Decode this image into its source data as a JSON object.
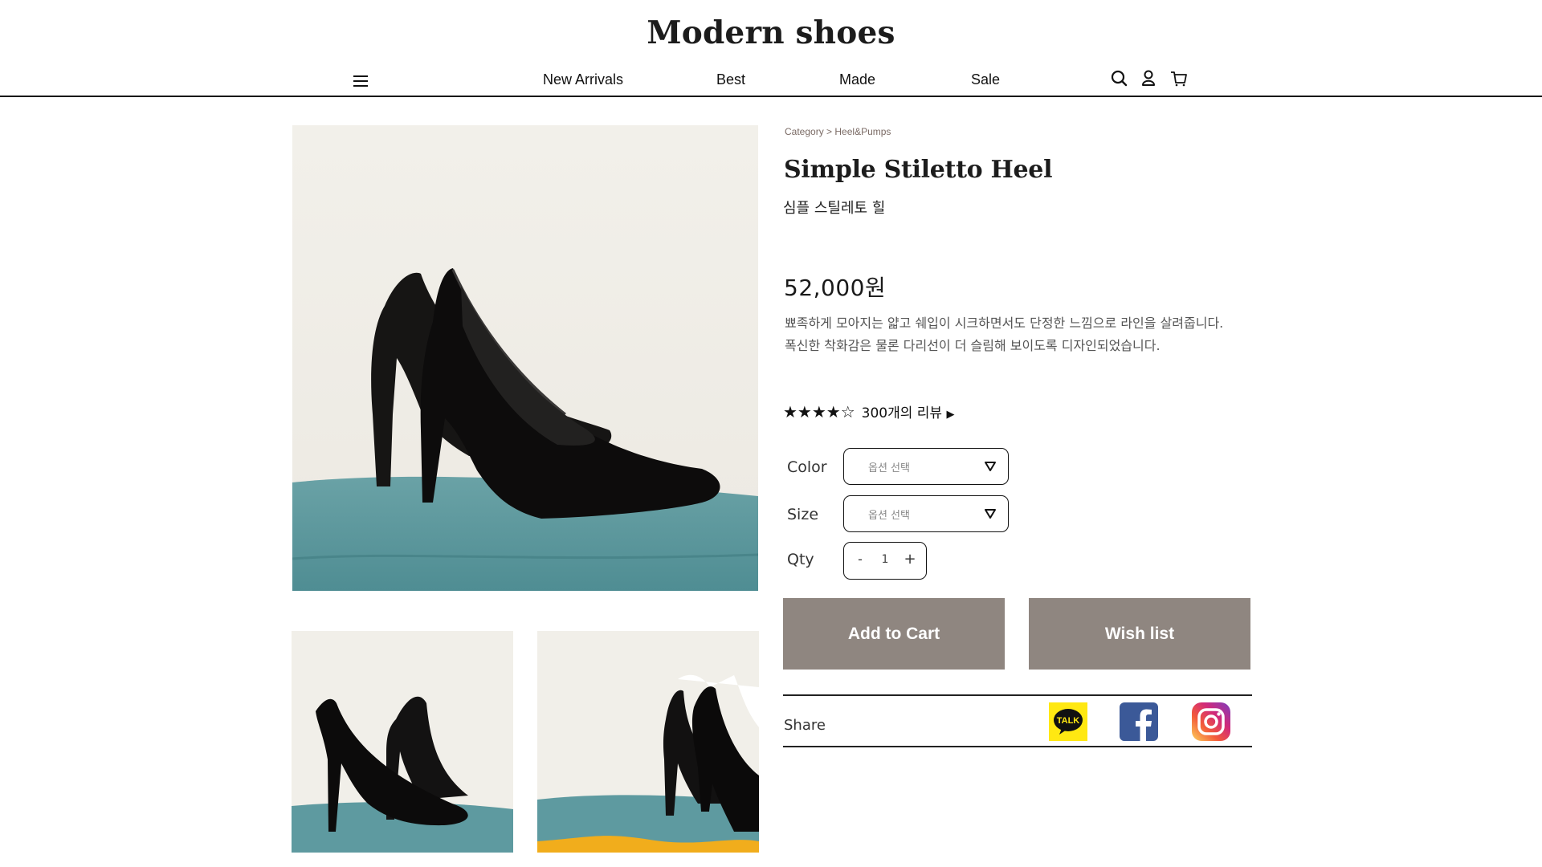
{
  "header": {
    "brand": "Modern shoes",
    "nav": [
      "New Arrivals",
      "Best",
      "Made",
      "Sale"
    ],
    "icons": [
      "menu-icon",
      "search-icon",
      "user-icon",
      "cart-icon"
    ]
  },
  "product": {
    "breadcrumb_root": "Category",
    "breadcrumb_sep": " > ",
    "breadcrumb_leaf": "Heel&Pumps",
    "title": "Simple Stiletto Heel",
    "subtitle": "심플 스틸레토 힐",
    "price": "52,000원",
    "description": [
      "뾰족하게 모아지는 얇고 쉐입이 시크하면서도 단정한 느낌으로 라인을 살려줍니다.",
      "폭신한 착화감은 물론 다리선이 더 슬림해 보이도록 디자인되었습니다."
    ],
    "rating": {
      "stars": "★★★★☆",
      "value": 4,
      "max": 5,
      "reviews_text": "300개의 리뷰",
      "arrow": "▶"
    }
  },
  "options": {
    "color": {
      "label": "Color",
      "placeholder": "옵션 선택"
    },
    "size": {
      "label": "Size",
      "placeholder": "옵션 선택"
    },
    "qty": {
      "label": "Qty",
      "minus": "-",
      "value": "1",
      "plus": "+"
    }
  },
  "actions": {
    "add_to_cart": "Add to Cart",
    "wish_list": "Wish list"
  },
  "share": {
    "label": "Share",
    "kakao_text": "TALK",
    "icons": [
      "kakaotalk-icon",
      "facebook-icon",
      "instagram-icon"
    ]
  },
  "colors": {
    "button_bg": "#8f8680",
    "accent_text": "#7a6a64",
    "kakao_yellow": "#ffe812",
    "facebook_blue": "#3b5998",
    "teal_surface": "#5e9aa0"
  }
}
